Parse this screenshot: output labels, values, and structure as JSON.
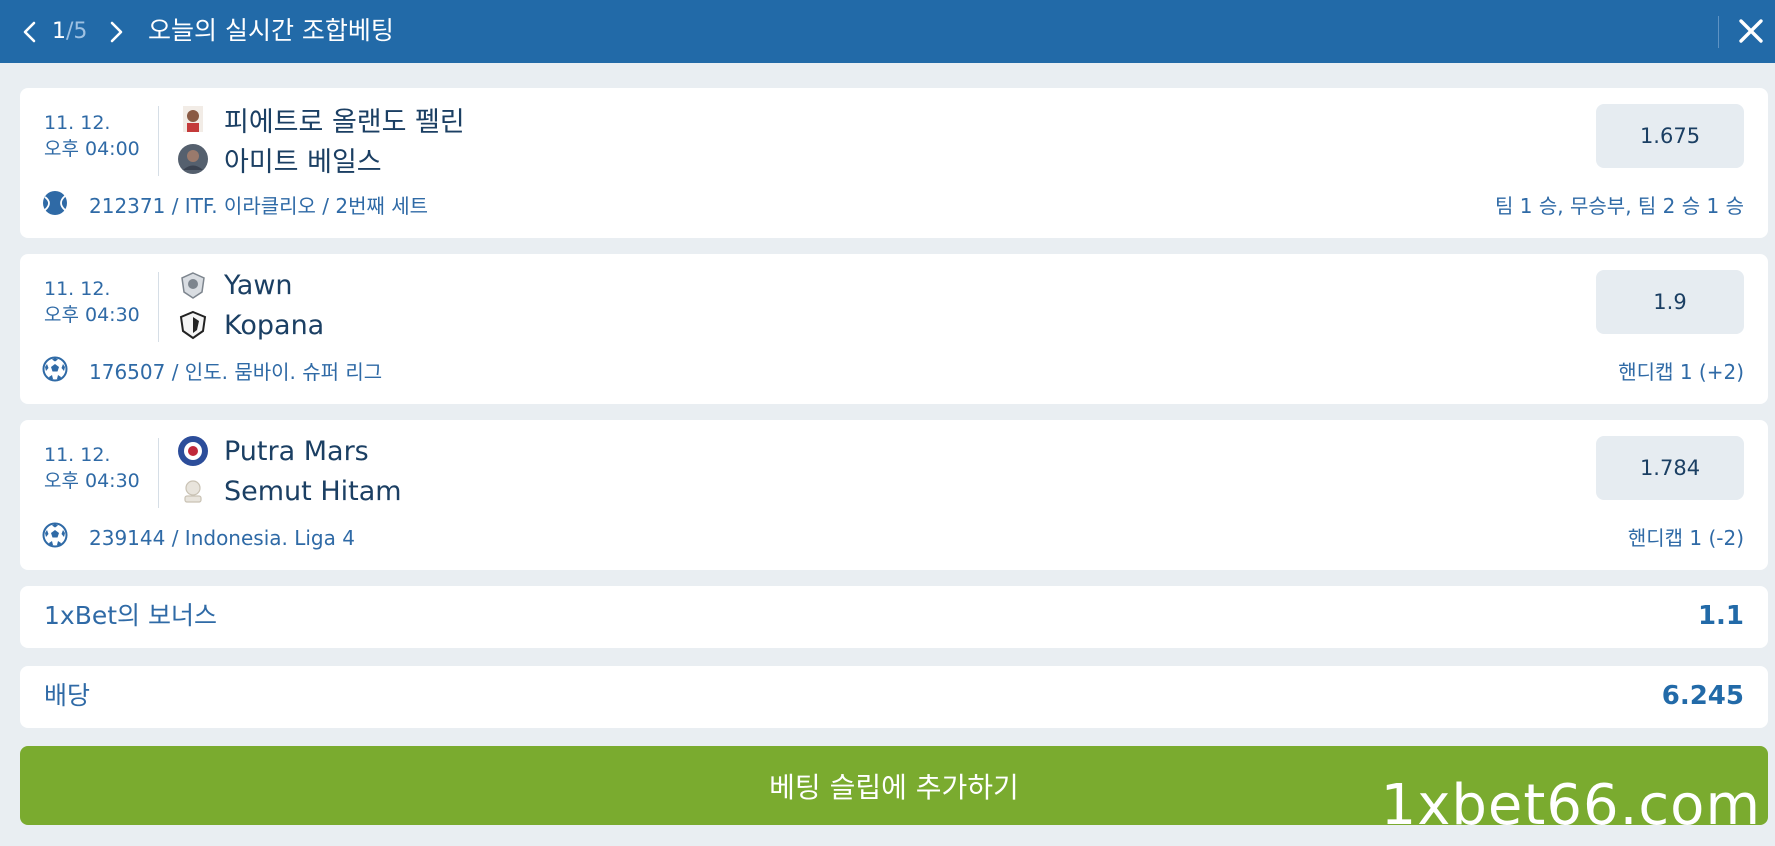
{
  "header": {
    "page_current": "1",
    "page_separator": "/",
    "page_total": "5",
    "title": "오늘의 실시간 조합베팅"
  },
  "events": [
    {
      "date": "11. 12.",
      "time": "오후 04:00",
      "team1": "피에트로 올랜도 펠린",
      "team2": "아미트 베일스",
      "odd": "1.675",
      "sport_icon": "tennis-ball-icon",
      "league": "212371 / ITF. 이라클리오 / 2번째 세트",
      "market": "팀 1 승, 무승부, 팀 2 승 1 승"
    },
    {
      "date": "11. 12.",
      "time": "오후 04:30",
      "team1": "Yawn",
      "team2": "Kopana",
      "odd": "1.9",
      "sport_icon": "soccer-ball-icon",
      "league": "176507 / 인도. 뭄바이. 슈퍼 리그",
      "market": "핸디캡 1 (+2)"
    },
    {
      "date": "11. 12.",
      "time": "오후 04:30",
      "team1": "Putra Mars",
      "team2": "Semut Hitam",
      "odd": "1.784",
      "sport_icon": "soccer-ball-icon",
      "league": "239144 / Indonesia. Liga 4",
      "market": "핸디캡 1 (-2)"
    }
  ],
  "bonus": {
    "label": "1xBet의 보너스",
    "value": "1.1"
  },
  "total_odds": {
    "label": "배당",
    "value": "6.245"
  },
  "add_button_label": "베팅 슬립에 추가하기",
  "watermark": "1xbet66.com",
  "colors": {
    "header": "#226aa8",
    "background": "#e9eef2",
    "accent_text": "#2f6aa6",
    "button_green": "#7aab2f",
    "odd_box": "#e6ecf1"
  }
}
